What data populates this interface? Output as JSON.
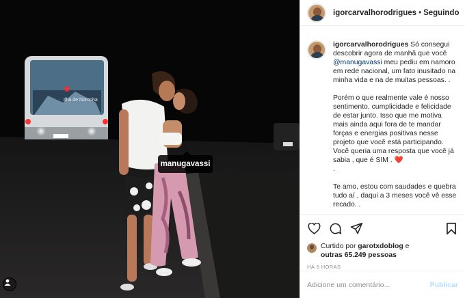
{
  "post": {
    "author": "igorcarvalhorodrigues",
    "separator": "•",
    "follow_status": "Seguindo",
    "photo_tag": "manugavassi",
    "bus_sign": "Ilha de Noronha"
  },
  "caption": {
    "username": "igorcarvalhorodrigues",
    "part1": " Só consegui descobrir agora de manhã que você ",
    "mention": "@manugavassi",
    "part2": " meu pediu em namoro em rede nacional, um fato inusitado na minha vida e na de muitas pessoas. .",
    "para2": "Porém o que realmente vale é nosso sentimento, cumplicidade e felicidade de estar junto. Isso que me motiva mais ainda aqui fora de te mandar forças e energias positivas nesse projeto que você está participando. Você queria uma resposta que você já sabia , que é SIM . ",
    "heart": "❤️",
    "dot_line": ".",
    "para3": "Te amo, estou com saudades e quebra tudo aí , daqui a 3 meses você vê esse recado. ."
  },
  "icons": {
    "like": "heart-outline",
    "comment": "speech-bubble",
    "share": "paper-plane",
    "save": "bookmark"
  },
  "likes": {
    "prefix": "Curtido por ",
    "user": "garotxdoblog",
    "connector": " e",
    "others": "outras 65.249 pessoas"
  },
  "timestamp": "HÁ 6 HORAS",
  "comment_input": {
    "placeholder": "Adicione um comentário...",
    "publish_label": "Publicar"
  },
  "colors": {
    "link": "#00376b",
    "publish_disabled": "#b2dffc",
    "heart": "#ed4956",
    "muted": "#8e8e8e"
  }
}
